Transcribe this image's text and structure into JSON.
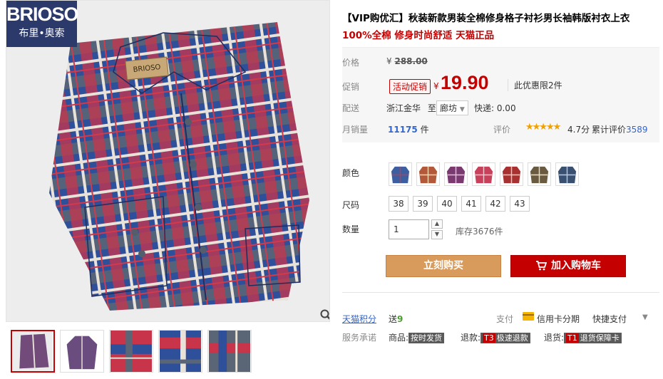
{
  "brand": {
    "name_en": "BRIOSO",
    "name_cn": "布里•奥索",
    "label_text": "BRIOSO"
  },
  "product": {
    "title": "【VIP购优汇】秋装新款男装全棉修身格子衬衫男长袖韩版衬衣上衣",
    "subtitle": "100%全棉 修身时尚舒适 天猫正品"
  },
  "price": {
    "label": "价格",
    "currency": "¥",
    "original": "288.00",
    "promo_label": "促销",
    "promo_tag": "活动促销",
    "current": "19.90",
    "limit_text": "此优惠限2件"
  },
  "shipping": {
    "label": "配送",
    "from": "浙江金华",
    "to_word": "至",
    "destination": "廊坊",
    "fee": "快递: 0.00"
  },
  "sales": {
    "label": "月销量",
    "count": "11175",
    "unit": "件",
    "rating_label": "评价",
    "stars": "★★★★★",
    "rating": "4.7分",
    "review_prefix": "累计评价",
    "review_count": "3589"
  },
  "options": {
    "color_label": "颜色",
    "colors": [
      {
        "main": "#3b5fa0",
        "accent": "#c43a4a"
      },
      {
        "main": "#b4583a",
        "accent": "#f0d8b0"
      },
      {
        "main": "#7a3a70",
        "accent": "#d8c0d8"
      },
      {
        "main": "#c8405a",
        "accent": "#f0c8d0"
      },
      {
        "main": "#a83030",
        "accent": "#e0d0c0"
      },
      {
        "main": "#6a5a40",
        "accent": "#e8e0c8"
      },
      {
        "main": "#3a5070",
        "accent": "#b8c8e0"
      }
    ],
    "size_label": "尺码",
    "sizes": [
      "38",
      "39",
      "40",
      "41",
      "42",
      "43"
    ],
    "qty_label": "数量",
    "qty_value": "1",
    "stock_text": "库存3676件"
  },
  "buttons": {
    "buy_now": "立刻购买",
    "add_cart": "加入购物车"
  },
  "services": {
    "points_label": "天猫积分",
    "points_prefix": "送",
    "points_value": "9",
    "pay_label": "支付",
    "pay_installment": "信用卡分期",
    "pay_quick": "快捷支付",
    "promise_label": "服务承诺",
    "goods_prefix": "商品:",
    "goods_tag": "按时发货",
    "refund_prefix": "退款:",
    "refund_code": "T3",
    "refund_tag": "极速退款",
    "return_prefix": "退货:",
    "return_code": "T1",
    "return_tag": "退货保障卡"
  },
  "colors": {
    "accent_red": "#c40000",
    "buy_orange": "#d89b5b",
    "link_blue": "#3366cc"
  }
}
